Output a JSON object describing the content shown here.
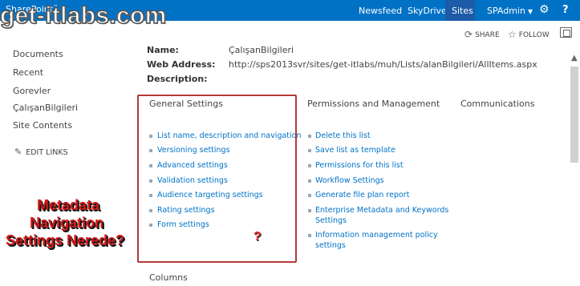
{
  "suitebar": {
    "brand": "SharePoint",
    "newsfeed": "Newsfeed",
    "skydrive": "SkyDrive",
    "sites": "Sites",
    "user": "SPAdmin",
    "help": "?"
  },
  "watermark": "get-itlabs.com",
  "commands": {
    "share": "SHARE",
    "follow": "FOLLOW"
  },
  "leftnav": {
    "items": [
      "Documents",
      "Recent",
      "Gorevler",
      "ÇalışanBilgileri",
      "Site Contents"
    ],
    "edit_links": "EDIT LINKS"
  },
  "annotation": {
    "line1": "Metadata",
    "line2": "Navigation",
    "line3": "Settings Nerede?",
    "question": "?"
  },
  "properties": {
    "name_label": "Name:",
    "name_value": "ÇalışanBilgileri",
    "address_label": "Web Address:",
    "address_value": "http://sps2013svr/sites/get-itlabs/muh/Lists/alanBilgileri/AllItems.aspx",
    "description_label": "Description:"
  },
  "sections": {
    "general": {
      "heading": "General Settings",
      "links": [
        "List name, description and navigation",
        "Versioning settings",
        "Advanced settings",
        "Validation settings",
        "Audience targeting settings",
        "Rating settings",
        "Form settings"
      ]
    },
    "permissions": {
      "heading": "Permissions and Management",
      "links": [
        "Delete this list",
        "Save list as template",
        "Permissions for this list",
        "Workflow Settings",
        "Generate file plan report",
        "Enterprise Metadata and Keywords Settings",
        "Information management policy settings"
      ]
    },
    "communications": {
      "heading": "Communications"
    },
    "columns_heading": "Columns"
  }
}
